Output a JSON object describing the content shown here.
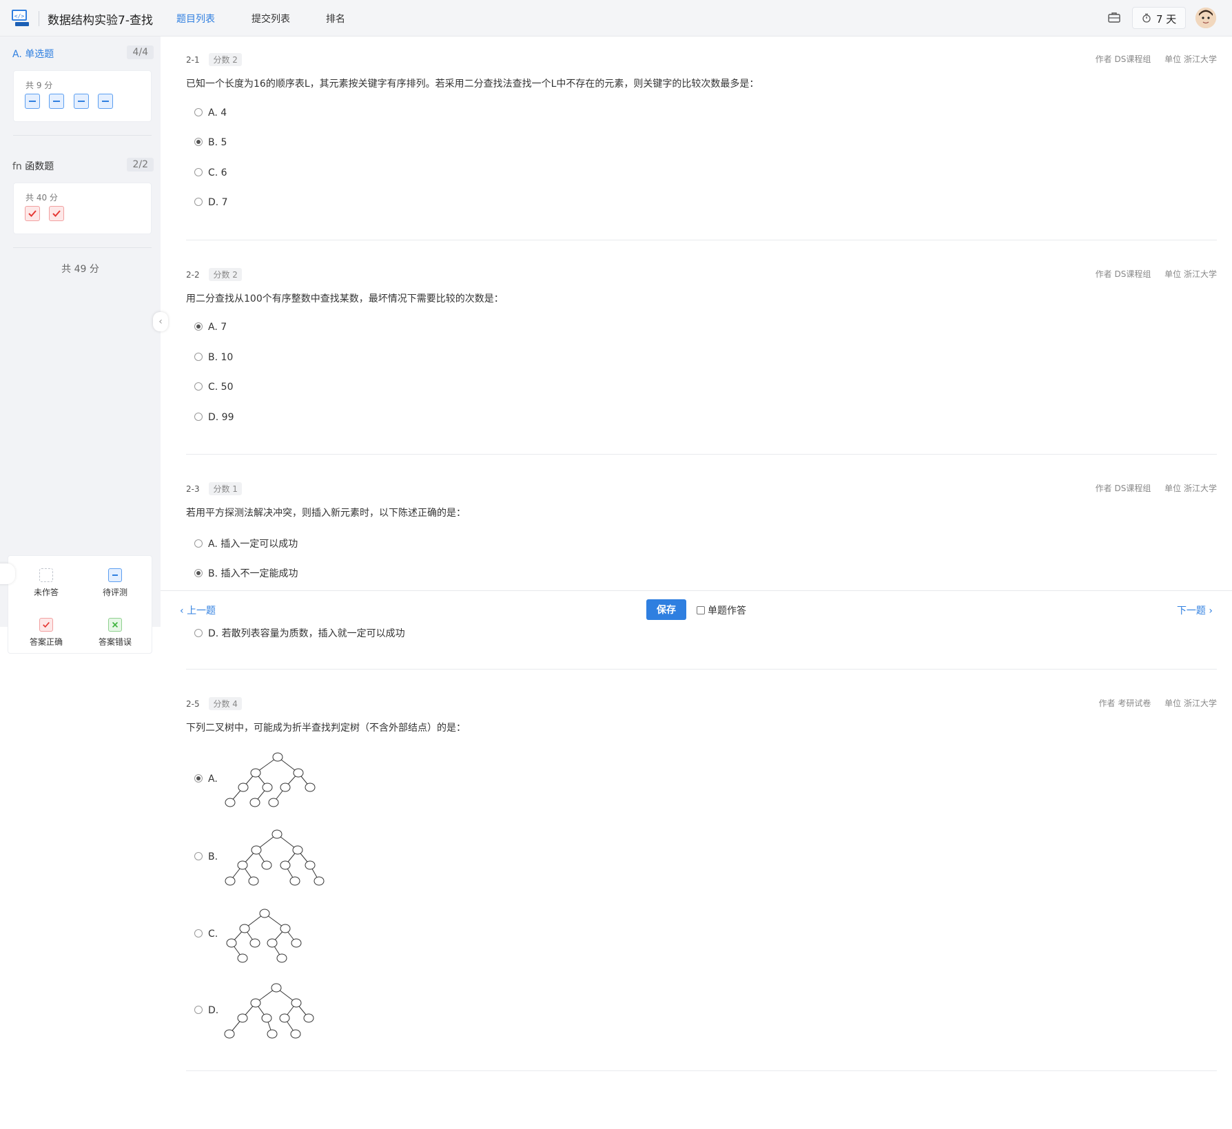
{
  "header": {
    "title": "数据结构实验7-查找",
    "tabs": [
      {
        "label": "题目列表",
        "active": true
      },
      {
        "label": "提交列表",
        "active": false
      },
      {
        "label": "排名",
        "active": false
      }
    ],
    "timer": "7 天",
    "accent_color": "#2f7fe0"
  },
  "sidebar": {
    "sections": [
      {
        "icon": "A.",
        "label": "单选题",
        "count": "4/4",
        "points": "共 9 分",
        "statuses": [
          "pending",
          "pending",
          "pending",
          "pending"
        ]
      },
      {
        "icon": "fn",
        "label": "函数题",
        "count": "2/2",
        "points": "共 40 分",
        "statuses": [
          "correct",
          "correct"
        ]
      }
    ],
    "total": "共 49 分",
    "legend": {
      "unanswered": "未作答",
      "pending": "待评测",
      "correct": "答案正确",
      "wrong": "答案错误"
    }
  },
  "questions": [
    {
      "id": "2-1",
      "score": "分数 2",
      "author": "作者 DS课程组",
      "org": "单位 浙江大学",
      "text": "已知一个长度为16的顺序表L，其元素按关键字有序排列。若采用二分查找法查找一个L中不存在的元素，则关键字的比较次数最多是：",
      "options": [
        "A. 4",
        "B. 5",
        "C. 6",
        "D. 7"
      ],
      "selected": 1
    },
    {
      "id": "2-2",
      "score": "分数 2",
      "author": "作者 DS课程组",
      "org": "单位 浙江大学",
      "text": "用二分查找从100个有序整数中查找某数，最坏情况下需要比较的次数是：",
      "options": [
        "A. 7",
        "B. 10",
        "C. 50",
        "D. 99"
      ],
      "selected": 0
    },
    {
      "id": "2-3",
      "score": "分数 1",
      "author": "作者 DS课程组",
      "org": "单位 浙江大学",
      "text": "若用平方探测法解决冲突，则插入新元素时，以下陈述正确的是：",
      "options": [
        "A. 插入一定可以成功",
        "B. 插入不一定能成功",
        "D. 若散列表容量为质数，插入就一定可以成功"
      ],
      "selected": 1
    },
    {
      "id": "2-5",
      "score": "分数 4",
      "author": "作者 考研试卷",
      "org": "单位 浙江大学",
      "text": "下列二叉树中，可能成为折半查找判定树（不含外部结点）的是：",
      "options": [
        "A.",
        "B.",
        "C.",
        "D."
      ],
      "selected": 0
    }
  ],
  "footer": {
    "prev": "上一题",
    "save": "保存",
    "single_mode": "单题作答",
    "next": "下一题"
  }
}
